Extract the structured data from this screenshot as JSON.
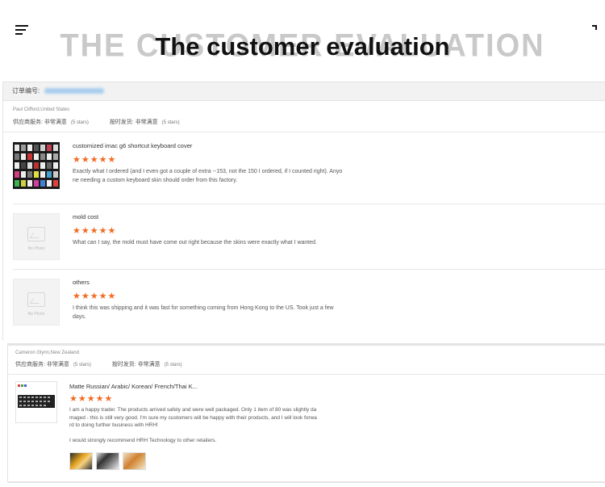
{
  "header": {
    "menu_icon": "hamburger-menu-icon",
    "title": "The customer evaluation",
    "title_shadow": "THE CUSTOMER EVALUATION"
  },
  "order": {
    "label": "订单编号:"
  },
  "evaluations": [
    {
      "buyer": "Paul Clifford,United States",
      "supplier_service_label": "供应商服务:",
      "supplier_service_value": "非常满意",
      "supplier_service_stars": "(5 stars)",
      "shipping_label": "按时发货:",
      "shipping_value": "非常满意",
      "shipping_stars": "(5 stars)",
      "items": [
        {
          "title": "customized imac g6 shortcut keyboard cover",
          "rating": 5,
          "stars": "★★★★★",
          "review_lines": [
            "Exactly what I ordered (and I even got a couple of extra --153, not the 150 I ordered, if I counted right).  Anyo",
            "ne needing a custom keyboard skin should order from this factory."
          ],
          "photo": "keyboard-cover-photo"
        },
        {
          "title": "mold cost",
          "rating": 5,
          "stars": "★★★★★",
          "review_lines": [
            "What can I say, the mold must have come out right because the skins were exactly what I wanted."
          ],
          "photo_placeholder": "No Photo"
        },
        {
          "title": "others",
          "rating": 5,
          "stars": "★★★★★",
          "review_lines": [
            "I think this was shipping and it was fast for something coming from Hong Kong to the US.  Took just a few",
            "days."
          ],
          "photo_placeholder": "No Photo"
        }
      ]
    },
    {
      "buyer": "Cameron Glynn,New Zealand",
      "supplier_service_label": "供应商服务:",
      "supplier_service_value": "非常满意",
      "supplier_service_stars": "(5 stars)",
      "shipping_label": "按时发货:",
      "shipping_value": "非常满意",
      "shipping_stars": "(5 stars)",
      "items": [
        {
          "title": "Matte Russian/ Arabic/ Korean/ French/Thai K...",
          "rating": 5,
          "stars": "★★★★★",
          "review_lines": [
            "I am a happy trader. The products arrived safely and were well packaged. Only 1 item of 80 was slightly da",
            "maged - this is still very good. I'm sure my customers will be happy with their products, and I will look forwa",
            "rd to doing further business with HRH!",
            "",
            "I would strongly recommend HRH Technology to other retailers."
          ],
          "photo": "keyboard-stickers-photo"
        }
      ]
    }
  ],
  "colors": {
    "star": "#f26a21",
    "order_bar": "#f2f2f2",
    "title": "#111111"
  }
}
